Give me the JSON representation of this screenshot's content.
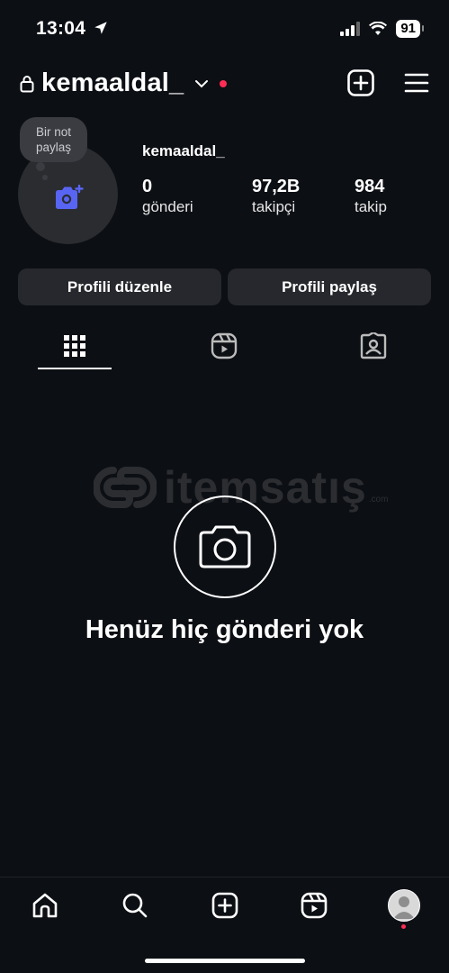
{
  "status_bar": {
    "time": "13:04",
    "battery": "91",
    "icons": [
      "location-arrow-icon",
      "signal-icon",
      "wifi-icon",
      "battery-icon"
    ]
  },
  "header": {
    "username": "kemaaldal_",
    "icons": [
      "lock-icon",
      "chevron-down-icon",
      "plus-square-icon",
      "menu-icon"
    ],
    "notification_color": "#ff2d55"
  },
  "profile": {
    "note_line1": "Bir not",
    "note_line2": "paylaş",
    "display_name": "kemaaldal_",
    "stats": [
      {
        "value": "0",
        "label": "gönderi"
      },
      {
        "value": "97,2B",
        "label": "takipçi"
      },
      {
        "value": "984",
        "label": "takip"
      }
    ],
    "accent": "#5865f2"
  },
  "actions": {
    "edit_profile": "Profili düzenle",
    "share_profile": "Profili paylaş"
  },
  "tabs": [
    "grid-icon",
    "reels-icon",
    "tagged-icon"
  ],
  "watermark": {
    "text": "itemsatış",
    "suffix": ".com"
  },
  "empty_state": {
    "title": "Henüz hiç gönderi yok",
    "icon": "camera-icon"
  },
  "bottom_nav": [
    "home-icon",
    "search-icon",
    "create-icon",
    "reels-icon",
    "profile-avatar"
  ]
}
